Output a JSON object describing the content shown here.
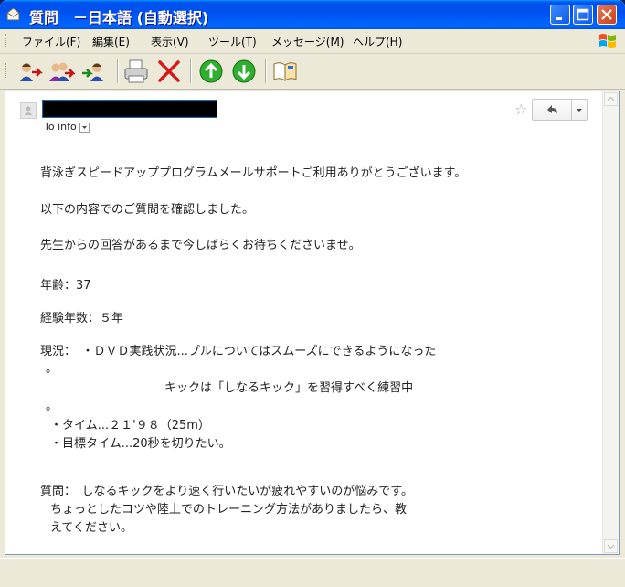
{
  "window": {
    "title": "質問　－日本語 (自動選択)"
  },
  "menu": {
    "items": [
      "ファイル(F)",
      "編集(E)",
      "表示(V)",
      "ツール(T)",
      "メッセージ(M)",
      "ヘルプ(H)"
    ]
  },
  "toolbar": {
    "icons": [
      "reply-icon",
      "reply-all-icon",
      "forward-icon",
      "print-icon",
      "delete-icon",
      "previous-icon",
      "next-icon",
      "address-book-icon"
    ]
  },
  "email": {
    "to_label": "To info",
    "lines": [
      "背泳ぎスピードアッププログラムメールサポートご利用ありがとうございます。",
      "以下の内容でのご質問を確認しました。",
      "先生からの回答があるまで今しばらくお待ちくださいませ。",
      "年齢：37",
      "経験年数：５年",
      "現況：　・ＤＶＤ実践状況...プルについてはスムーズにできるようになった",
      "。",
      "キックは「しなるキック」を習得すべく練習中",
      "。",
      "・タイム...２１'９８（25m）",
      "・目標タイム...20秒を切りたい。",
      "質問：　しなるキックをより速く行いたいが疲れやすいのが悩みです。",
      "ちょっとしたコツや陸上でのトレーニング方法がありましたら、教",
      "えてください。"
    ]
  },
  "colors": {
    "titlebar": "#0054e3",
    "close_button": "#c9401b",
    "window_bg": "#ece9d8"
  }
}
